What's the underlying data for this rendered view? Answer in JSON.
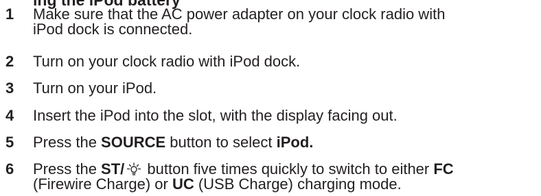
{
  "heading_fragment": "ing the iPod battery",
  "steps": [
    {
      "number": "1",
      "line1": "Make sure that the AC power adapter on your clock radio with",
      "line2": "iPod dock is connected."
    },
    {
      "number": "2",
      "text": "Turn on your clock radio with iPod dock."
    },
    {
      "number": "3",
      "text": "Turn on your iPod."
    },
    {
      "number": "4",
      "text": "Insert the iPod into the slot, with the display facing out."
    },
    {
      "number": "5",
      "pre": "Press the ",
      "button": "SOURCE",
      "mid": " button to select ",
      "target": "iPod."
    },
    {
      "number": "6",
      "pre": "Press the ",
      "button": "ST/",
      "icon": "brightness-icon",
      "mid": " button five times quickly to switch to either ",
      "mode1": "FC",
      "line2_pre": "(Firewire Charge) or ",
      "mode2": "UC",
      "line2_post": " (USB Charge) charging mode."
    }
  ]
}
